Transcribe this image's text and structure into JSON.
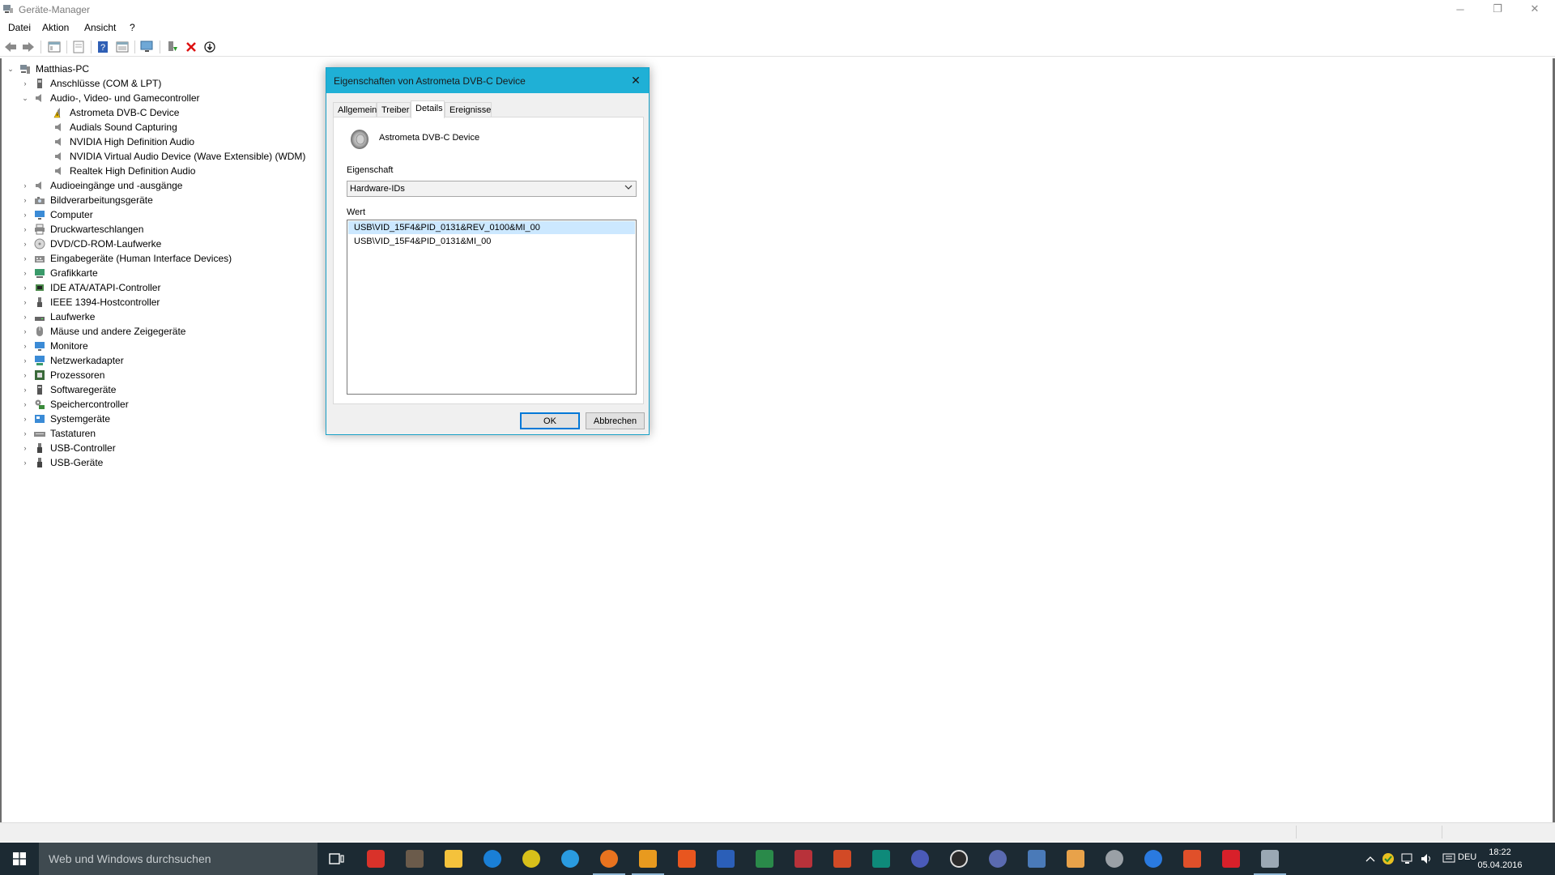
{
  "window": {
    "title": "Geräte-Manager",
    "controls": {
      "minimize": "─",
      "restore": "❐",
      "close": "✕"
    }
  },
  "menu": [
    "Datei",
    "Aktion",
    "Ansicht",
    "?"
  ],
  "toolbar": {
    "buttons": [
      "back-icon",
      "forward-icon",
      "tree-view-icon",
      "properties-icon",
      "help-icon",
      "action-view-icon",
      "scan-hardware-icon",
      "update-driver-icon",
      "uninstall-icon",
      "disable-device-icon"
    ]
  },
  "tree": {
    "root": "Matthias-PC",
    "categories": [
      {
        "label": "Anschlüsse (COM & LPT)",
        "expanded": false
      },
      {
        "label": "Audio-, Video- und Gamecontroller",
        "expanded": true,
        "children": [
          {
            "label": "Astrometa DVB-C Device",
            "warning": true
          },
          {
            "label": "Audials Sound Capturing"
          },
          {
            "label": "NVIDIA High Definition Audio"
          },
          {
            "label": "NVIDIA Virtual Audio Device (Wave Extensible) (WDM)"
          },
          {
            "label": "Realtek High Definition Audio"
          }
        ]
      },
      {
        "label": "Audioeingänge und -ausgänge"
      },
      {
        "label": "Bildverarbeitungsgeräte"
      },
      {
        "label": "Computer"
      },
      {
        "label": "Druckwarteschlangen"
      },
      {
        "label": "DVD/CD-ROM-Laufwerke"
      },
      {
        "label": "Eingabegeräte (Human Interface Devices)"
      },
      {
        "label": "Grafikkarte"
      },
      {
        "label": "IDE ATA/ATAPI-Controller"
      },
      {
        "label": "IEEE 1394-Hostcontroller"
      },
      {
        "label": "Laufwerke"
      },
      {
        "label": "Mäuse und andere Zeigegeräte"
      },
      {
        "label": "Monitore"
      },
      {
        "label": "Netzwerkadapter"
      },
      {
        "label": "Prozessoren"
      },
      {
        "label": "Softwaregeräte"
      },
      {
        "label": "Speichercontroller"
      },
      {
        "label": "Systemgeräte"
      },
      {
        "label": "Tastaturen"
      },
      {
        "label": "USB-Controller"
      },
      {
        "label": "USB-Geräte"
      }
    ]
  },
  "dialog": {
    "title": "Eigenschaften von Astrometa DVB-C Device",
    "close": "✕",
    "tabs": [
      "Allgemein",
      "Treiber",
      "Details",
      "Ereignisse"
    ],
    "active_tab": "Details",
    "device_name": "Astrometa DVB-C Device",
    "property_label": "Eigenschaft",
    "property_value": "Hardware-IDs",
    "value_label": "Wert",
    "values": [
      "USB\\VID_15F4&PID_0131&REV_0100&MI_00",
      "USB\\VID_15F4&PID_0131&MI_00"
    ],
    "selected_value_index": 0,
    "ok": "OK",
    "cancel": "Abbrechen"
  },
  "taskbar": {
    "search_placeholder": "Web und Windows durchsuchen",
    "apps": [
      "task-view-icon",
      "app-red-icon",
      "app-tool-icon",
      "file-explorer-icon",
      "edge-icon",
      "app-yellow-icon",
      "internet-explorer-icon",
      "firefox-icon",
      "outlook-icon",
      "mail-icon",
      "word-icon",
      "excel-icon",
      "access-icon",
      "powerpoint-icon",
      "publisher-icon",
      "webcam-icon",
      "app-circle-icon",
      "app-globe-icon",
      "steam-icon",
      "media-player-icon",
      "app-gear-icon",
      "app-blue-circle-icon",
      "app-red-wave-icon",
      "mp3-icon",
      "device-manager-icon"
    ],
    "tray": {
      "language": "DEU",
      "time": "18:22",
      "date": "05.04.2016"
    }
  },
  "colors": {
    "dialog_titlebar": "#1fb0d6",
    "taskbar": "#1c2a33",
    "selection": "#cce8ff",
    "default_button_border": "#0078d7"
  }
}
